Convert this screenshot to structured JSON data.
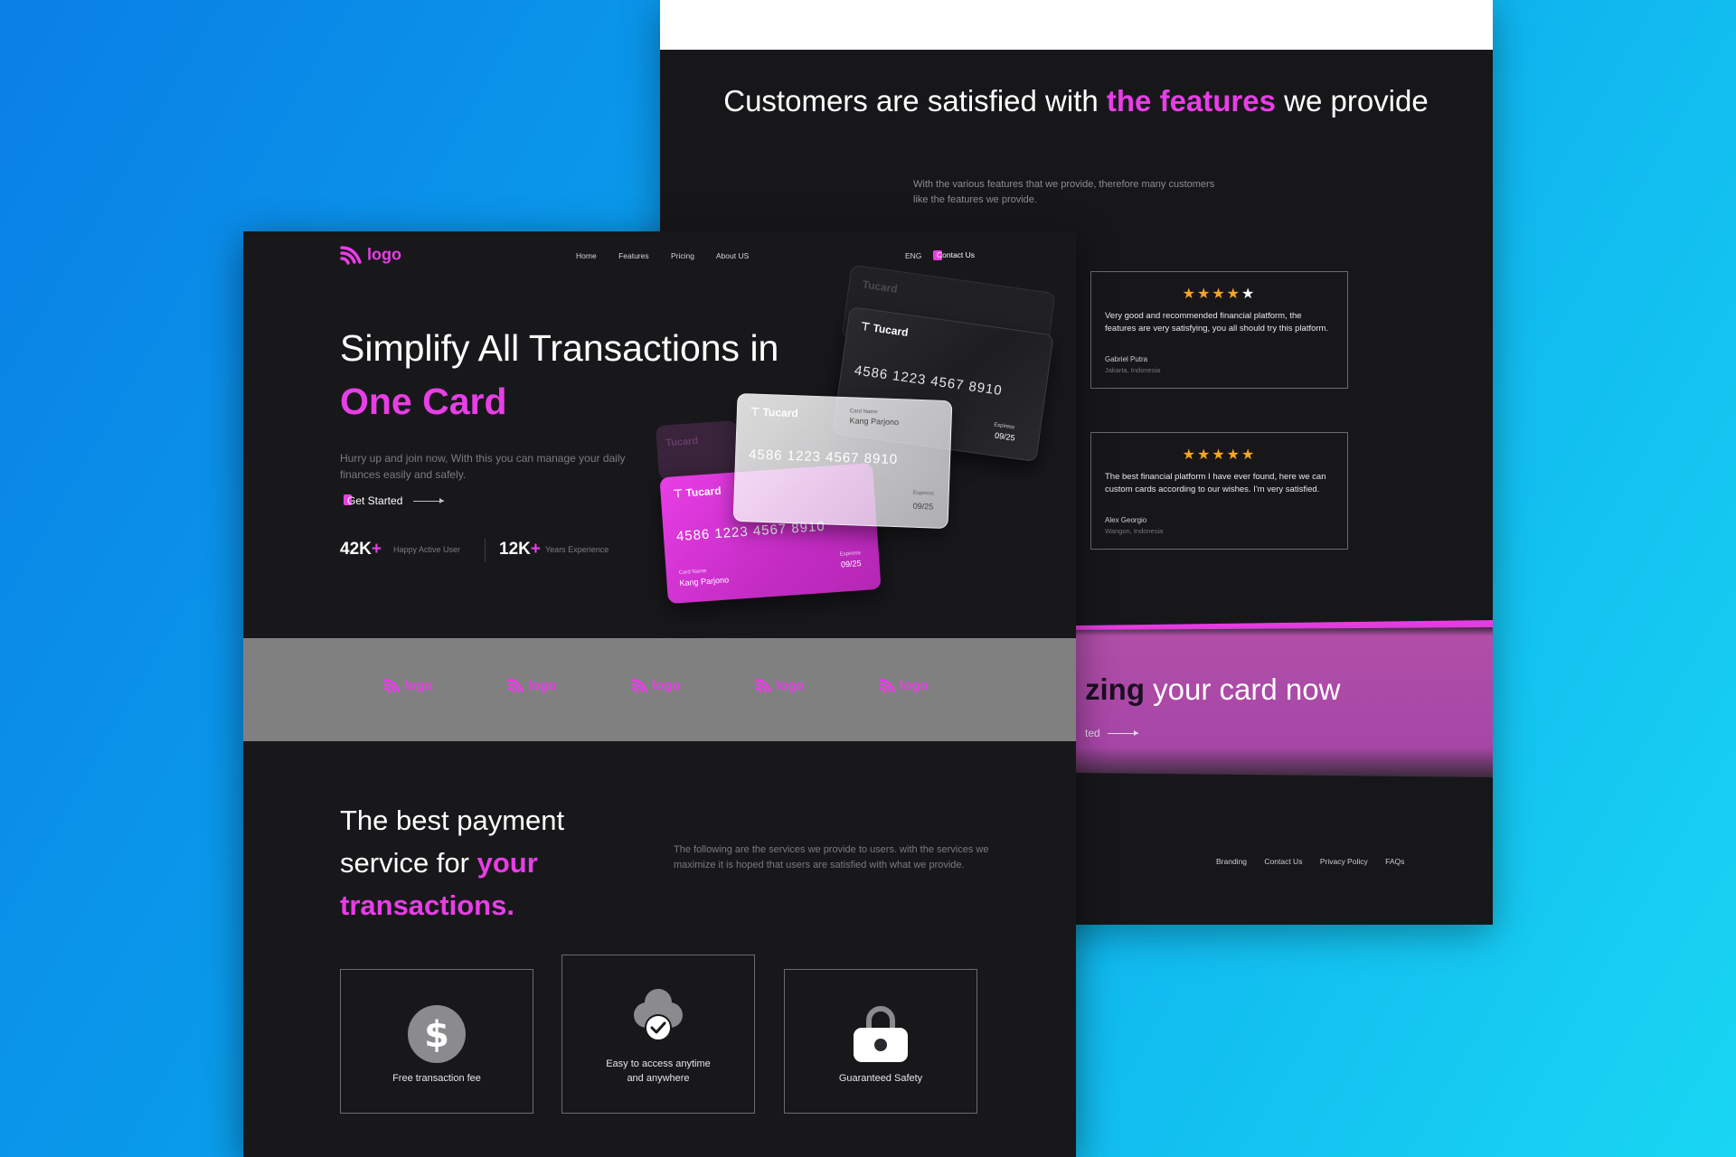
{
  "back": {
    "title_pre": "Customers are satisfied with ",
    "title_highlight": "the features",
    "title_post": " we provide",
    "subtitle": "With the various features that we provide, therefore many customers like the features we provide.",
    "reviews": [
      {
        "stars": 4,
        "text": "Very good and recommended financial platform, the features are very satisfying, you all should try this platform.",
        "name": "Gabriel Putra",
        "location": "Jakarta, Indonesia"
      },
      {
        "stars": 5,
        "text": "The best financial platform I have ever found, here we can custom cards according to our wishes. I'm very satisfied.",
        "name": "Alex Georgio",
        "location": "Wangon, Indonesia"
      }
    ],
    "cta": {
      "title_dark": "zing",
      "title_rest": " your card now",
      "link": "ted"
    },
    "footer_links": [
      "Branding",
      "Contact Us",
      "Privacy Policy",
      "FAQs"
    ]
  },
  "front": {
    "logo_text": "logo",
    "nav": [
      "Home",
      "Features",
      "Pricing",
      "About US"
    ],
    "lang": "ENG",
    "contact": "Contact Us",
    "hero_title_line1": "Simplify All Transactions in",
    "hero_title_line2": "One Card",
    "hero_sub": "Hurry up and join now, With this you can manage your daily finances easily and safely.",
    "cta": "Get Started",
    "stats": [
      {
        "value": "42K",
        "plus": "+",
        "label": "Happy Active User"
      },
      {
        "value": "12K",
        "plus": "+",
        "label": "Years Experience"
      }
    ],
    "cards": {
      "brand": "Tucard",
      "number": "4586 1223 4567 8910",
      "name_label": "Card Name",
      "name": "Kang Parjono",
      "exp_label": "Expiress",
      "exp": "09/25"
    },
    "band_logos": [
      "logo",
      "logo",
      "logo",
      "logo",
      "logo"
    ],
    "pay_title_pre": "The best payment service for ",
    "pay_title_highlight": "your transactions.",
    "pay_sub": "The following are the services we provide to users. with the services we maximize it is hoped that users are satisfied with what we provide.",
    "features": [
      "Free transaction fee",
      "Easy to access anytime and anywhere",
      "Guaranteed Safety"
    ]
  },
  "colors": {
    "accent": "#e83ee6",
    "bg_dark": "#18181b",
    "star": "#f5a623",
    "band": "#808080"
  }
}
